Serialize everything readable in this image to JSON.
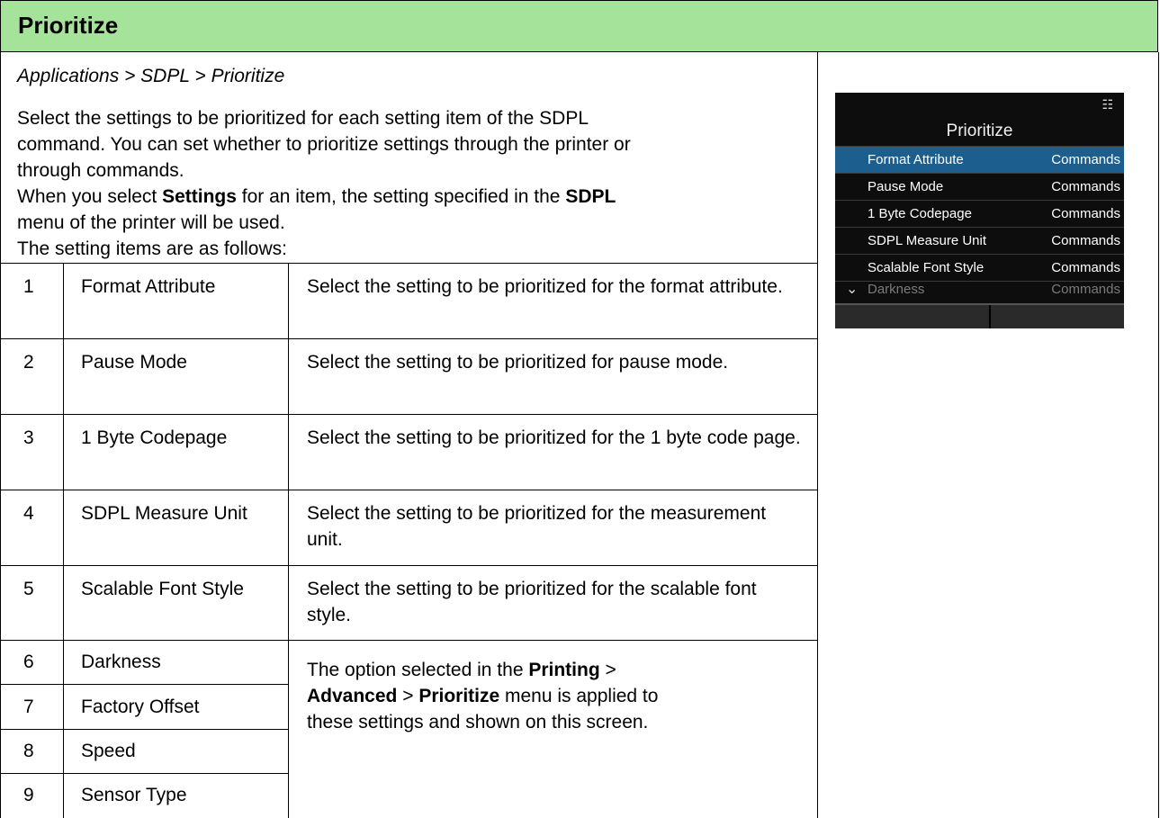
{
  "title": "Prioritize",
  "breadcrumb": "Applications > SDPL > Prioritize",
  "intro": {
    "line1": "Select the settings to be prioritized for each setting item of the SDPL",
    "line2": "command. You can set whether to prioritize settings through the printer or",
    "line3": "through commands.",
    "line4_a": "When you select ",
    "line4_b": "Settings",
    "line4_c": " for an item, the setting specified in the ",
    "line4_d": "SDPL",
    "line5": "menu of the printer will be used.",
    "line6": "The setting items are as follows:"
  },
  "table": {
    "rows": [
      {
        "num": "1",
        "item": "Format Attribute",
        "desc": "Select the setting to be prioritized for the format attribute."
      },
      {
        "num": "2",
        "item": "Pause Mode",
        "desc": "Select the setting to be prioritized for pause mode."
      },
      {
        "num": "3",
        "item": "1 Byte Codepage",
        "desc": "Select the setting to be prioritized for the 1 byte code page."
      },
      {
        "num": "4",
        "item": "SDPL Measure Unit",
        "desc": "Select the setting to be prioritized for the measurement unit."
      },
      {
        "num": "5",
        "item": "Scalable Font Style",
        "desc": "Select the setting to be prioritized for the scalable font style."
      },
      {
        "num": "6",
        "item": "Darkness"
      },
      {
        "num": "7",
        "item": "Factory Offset"
      },
      {
        "num": "8",
        "item": "Speed"
      },
      {
        "num": "9",
        "item": "Sensor Type"
      }
    ],
    "shared_desc": {
      "a": "The option selected in the ",
      "b": "Printing",
      "c": " >",
      "d": "Advanced",
      "e": " > ",
      "f": "Prioritize",
      "g": " menu is applied to",
      "h": "these settings and shown on this screen."
    }
  },
  "lcd": {
    "title": "Prioritize",
    "network_icon": "network-icon",
    "rows": [
      {
        "label": "Format Attribute",
        "value": "Commands"
      },
      {
        "label": "Pause Mode",
        "value": "Commands"
      },
      {
        "label": "1 Byte Codepage",
        "value": "Commands"
      },
      {
        "label": "SDPL Measure Unit",
        "value": "Commands"
      },
      {
        "label": "Scalable Font Style",
        "value": "Commands"
      },
      {
        "label": "Darkness",
        "value": "Commands"
      }
    ],
    "selected_row": 0,
    "colors": {
      "selected": "#1c5f8f",
      "background": "#0d0d0d"
    }
  },
  "colors": {
    "title_bar": "#a6e39a"
  }
}
